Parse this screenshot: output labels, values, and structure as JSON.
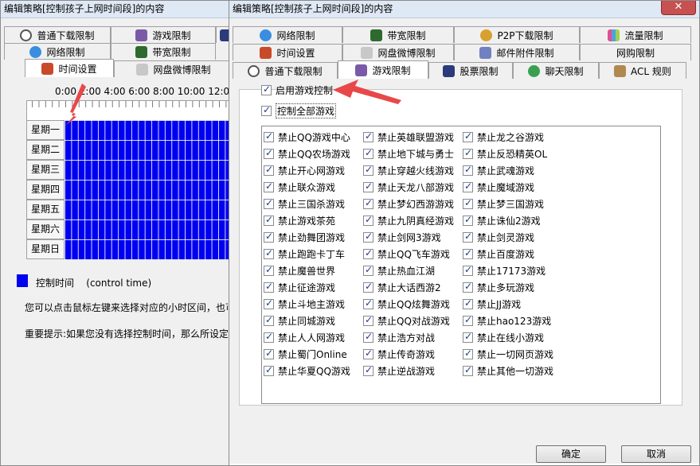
{
  "windowA": {
    "title": "编辑策略[控制孩子上网时间段]的内容",
    "tabs_row1": [
      "普通下载限制",
      "游戏限制"
    ],
    "tabs_row2": [
      "网络限制",
      "带宽限制"
    ],
    "tabs_row3": [
      "时间设置",
      "网盘微博限制"
    ],
    "hours": "0:00 2:00  4:00  6:00  8:00 10:00 12:00",
    "days": [
      "星期一",
      "星期二",
      "星期三",
      "星期四",
      "星期五",
      "星期六",
      "星期日"
    ],
    "legend_label": "控制时间",
    "legend_en": "(control time)",
    "hint1": "您可以点击鼠标左键来选择对应的小时区间，也可",
    "hint2": "重要提示:如果您没有选择控制时间，那么所设定"
  },
  "windowB": {
    "title": "编辑策略[控制孩子上网时间段]的内容",
    "close": "✕",
    "tabs_row1": [
      "网络限制",
      "带宽限制",
      "P2P下载限制",
      "流量限制"
    ],
    "tabs_row2": [
      "时间设置",
      "网盘微博限制",
      "邮件附件限制",
      "网购限制"
    ],
    "tabs_row3": [
      "普通下载限制",
      "游戏限制",
      "股票限制",
      "聊天限制",
      "ACL 规则"
    ],
    "enable_label": "启用游戏控制",
    "all_label": "控制全部游戏",
    "col1": [
      "禁止QQ游戏中心",
      "禁止QQ农场游戏",
      "禁止开心网游戏",
      "禁止联众游戏",
      "禁止三国杀游戏",
      "禁止游戏茶苑",
      "禁止劲舞团游戏",
      "禁止跑跑卡丁车",
      "禁止魔兽世界",
      "禁止征途游戏",
      "禁止斗地主游戏",
      "禁止同城游戏",
      "禁止人人网游戏",
      "禁止蜀门Online",
      "禁止华夏QQ游戏"
    ],
    "col2": [
      "禁止英雄联盟游戏",
      "禁止地下城与勇士",
      "禁止穿越火线游戏",
      "禁止天龙八部游戏",
      "禁止梦幻西游游戏",
      "禁止九阴真经游戏",
      "禁止剑网3游戏",
      "禁止QQ飞车游戏",
      "禁止热血江湖",
      "禁止大话西游2",
      "禁止QQ炫舞游戏",
      "禁止QQ对战游戏",
      "禁止浩方对战",
      "禁止传奇游戏",
      "禁止逆战游戏"
    ],
    "col3": [
      "禁止龙之谷游戏",
      "禁止反恐精英OL",
      "禁止武魂游戏",
      "禁止魔域游戏",
      "禁止梦三国游戏",
      "禁止诛仙2游戏",
      "禁止剑灵游戏",
      "禁止百度游戏",
      "禁止17173游戏",
      "禁止多玩游戏",
      "禁止JJ游戏",
      "禁止hao123游戏",
      "禁止在线小游戏",
      "禁止一切网页游戏",
      "禁止其他一切游戏"
    ],
    "ok": "确定",
    "cancel": "取消"
  },
  "colors": {
    "grid_blue": "#0000f0",
    "arrow_red": "#e8484a",
    "close_red": "#c75050"
  }
}
